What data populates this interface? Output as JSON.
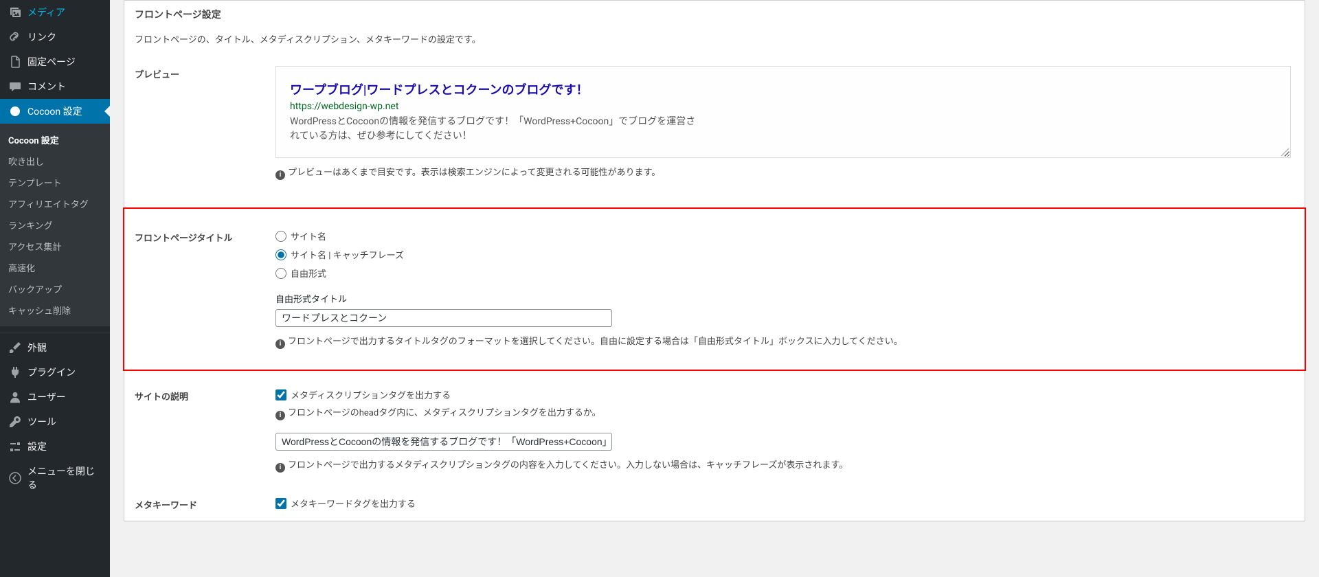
{
  "sidebar": {
    "items": [
      {
        "label": "メディア"
      },
      {
        "label": "リンク"
      },
      {
        "label": "固定ページ"
      },
      {
        "label": "コメント"
      },
      {
        "label": "Cocoon 設定",
        "active": true
      }
    ],
    "sub": [
      {
        "label": "Cocoon 設定",
        "current": true
      },
      {
        "label": "吹き出し"
      },
      {
        "label": "テンプレート"
      },
      {
        "label": "アフィリエイトタグ"
      },
      {
        "label": "ランキング"
      },
      {
        "label": "アクセス集計"
      },
      {
        "label": "高速化"
      },
      {
        "label": "バックアップ"
      },
      {
        "label": "キャッシュ削除"
      }
    ],
    "bottom": [
      {
        "label": "外観"
      },
      {
        "label": "プラグイン"
      },
      {
        "label": "ユーザー"
      },
      {
        "label": "ツール"
      },
      {
        "label": "設定"
      },
      {
        "label": "メニューを閉じる"
      }
    ]
  },
  "front": {
    "heading": "フロントページ設定",
    "desc": "フロントページの、タイトル、メタディスクリプション、メタキーワードの設定です。"
  },
  "preview": {
    "label": "プレビュー",
    "title": "ワープブログ|ワードプレスとコクーンのブログです！",
    "url": "https://webdesign-wp.net",
    "desc": "WordPressとCocoonの情報を発信するブログです！「WordPress+Cocoon」でブログを運営されている方は、ぜひ参考にしてください！",
    "help": "プレビューはあくまで目安です。表示は検索エンジンによって変更される可能性があります。"
  },
  "titleSection": {
    "label": "フロントページタイトル",
    "options": {
      "sitename": "サイト名",
      "sitename_catch": "サイト名 | キャッチフレーズ",
      "free": "自由形式"
    },
    "free_label": "自由形式タイトル",
    "free_value": "ワードプレスとコクーン",
    "help": "フロントページで出力するタイトルタグのフォーマットを選択してください。自由に設定する場合は「自由形式タイトル」ボックスに入力してください。"
  },
  "siteDesc": {
    "label": "サイトの説明",
    "checkbox": "メタディスクリプションタグを出力する",
    "help1": "フロントページのheadタグ内に、メタディスクリプションタグを出力するか。",
    "value": "WordPressとCocoonの情報を発信するブログです！「WordPress+Cocoon」",
    "help2": "フロントページで出力するメタディスクリプションタグの内容を入力してください。入力しない場合は、キャッチフレーズが表示されます。"
  },
  "metaKeyword": {
    "label": "メタキーワード",
    "checkbox": "メタキーワードタグを出力する"
  }
}
